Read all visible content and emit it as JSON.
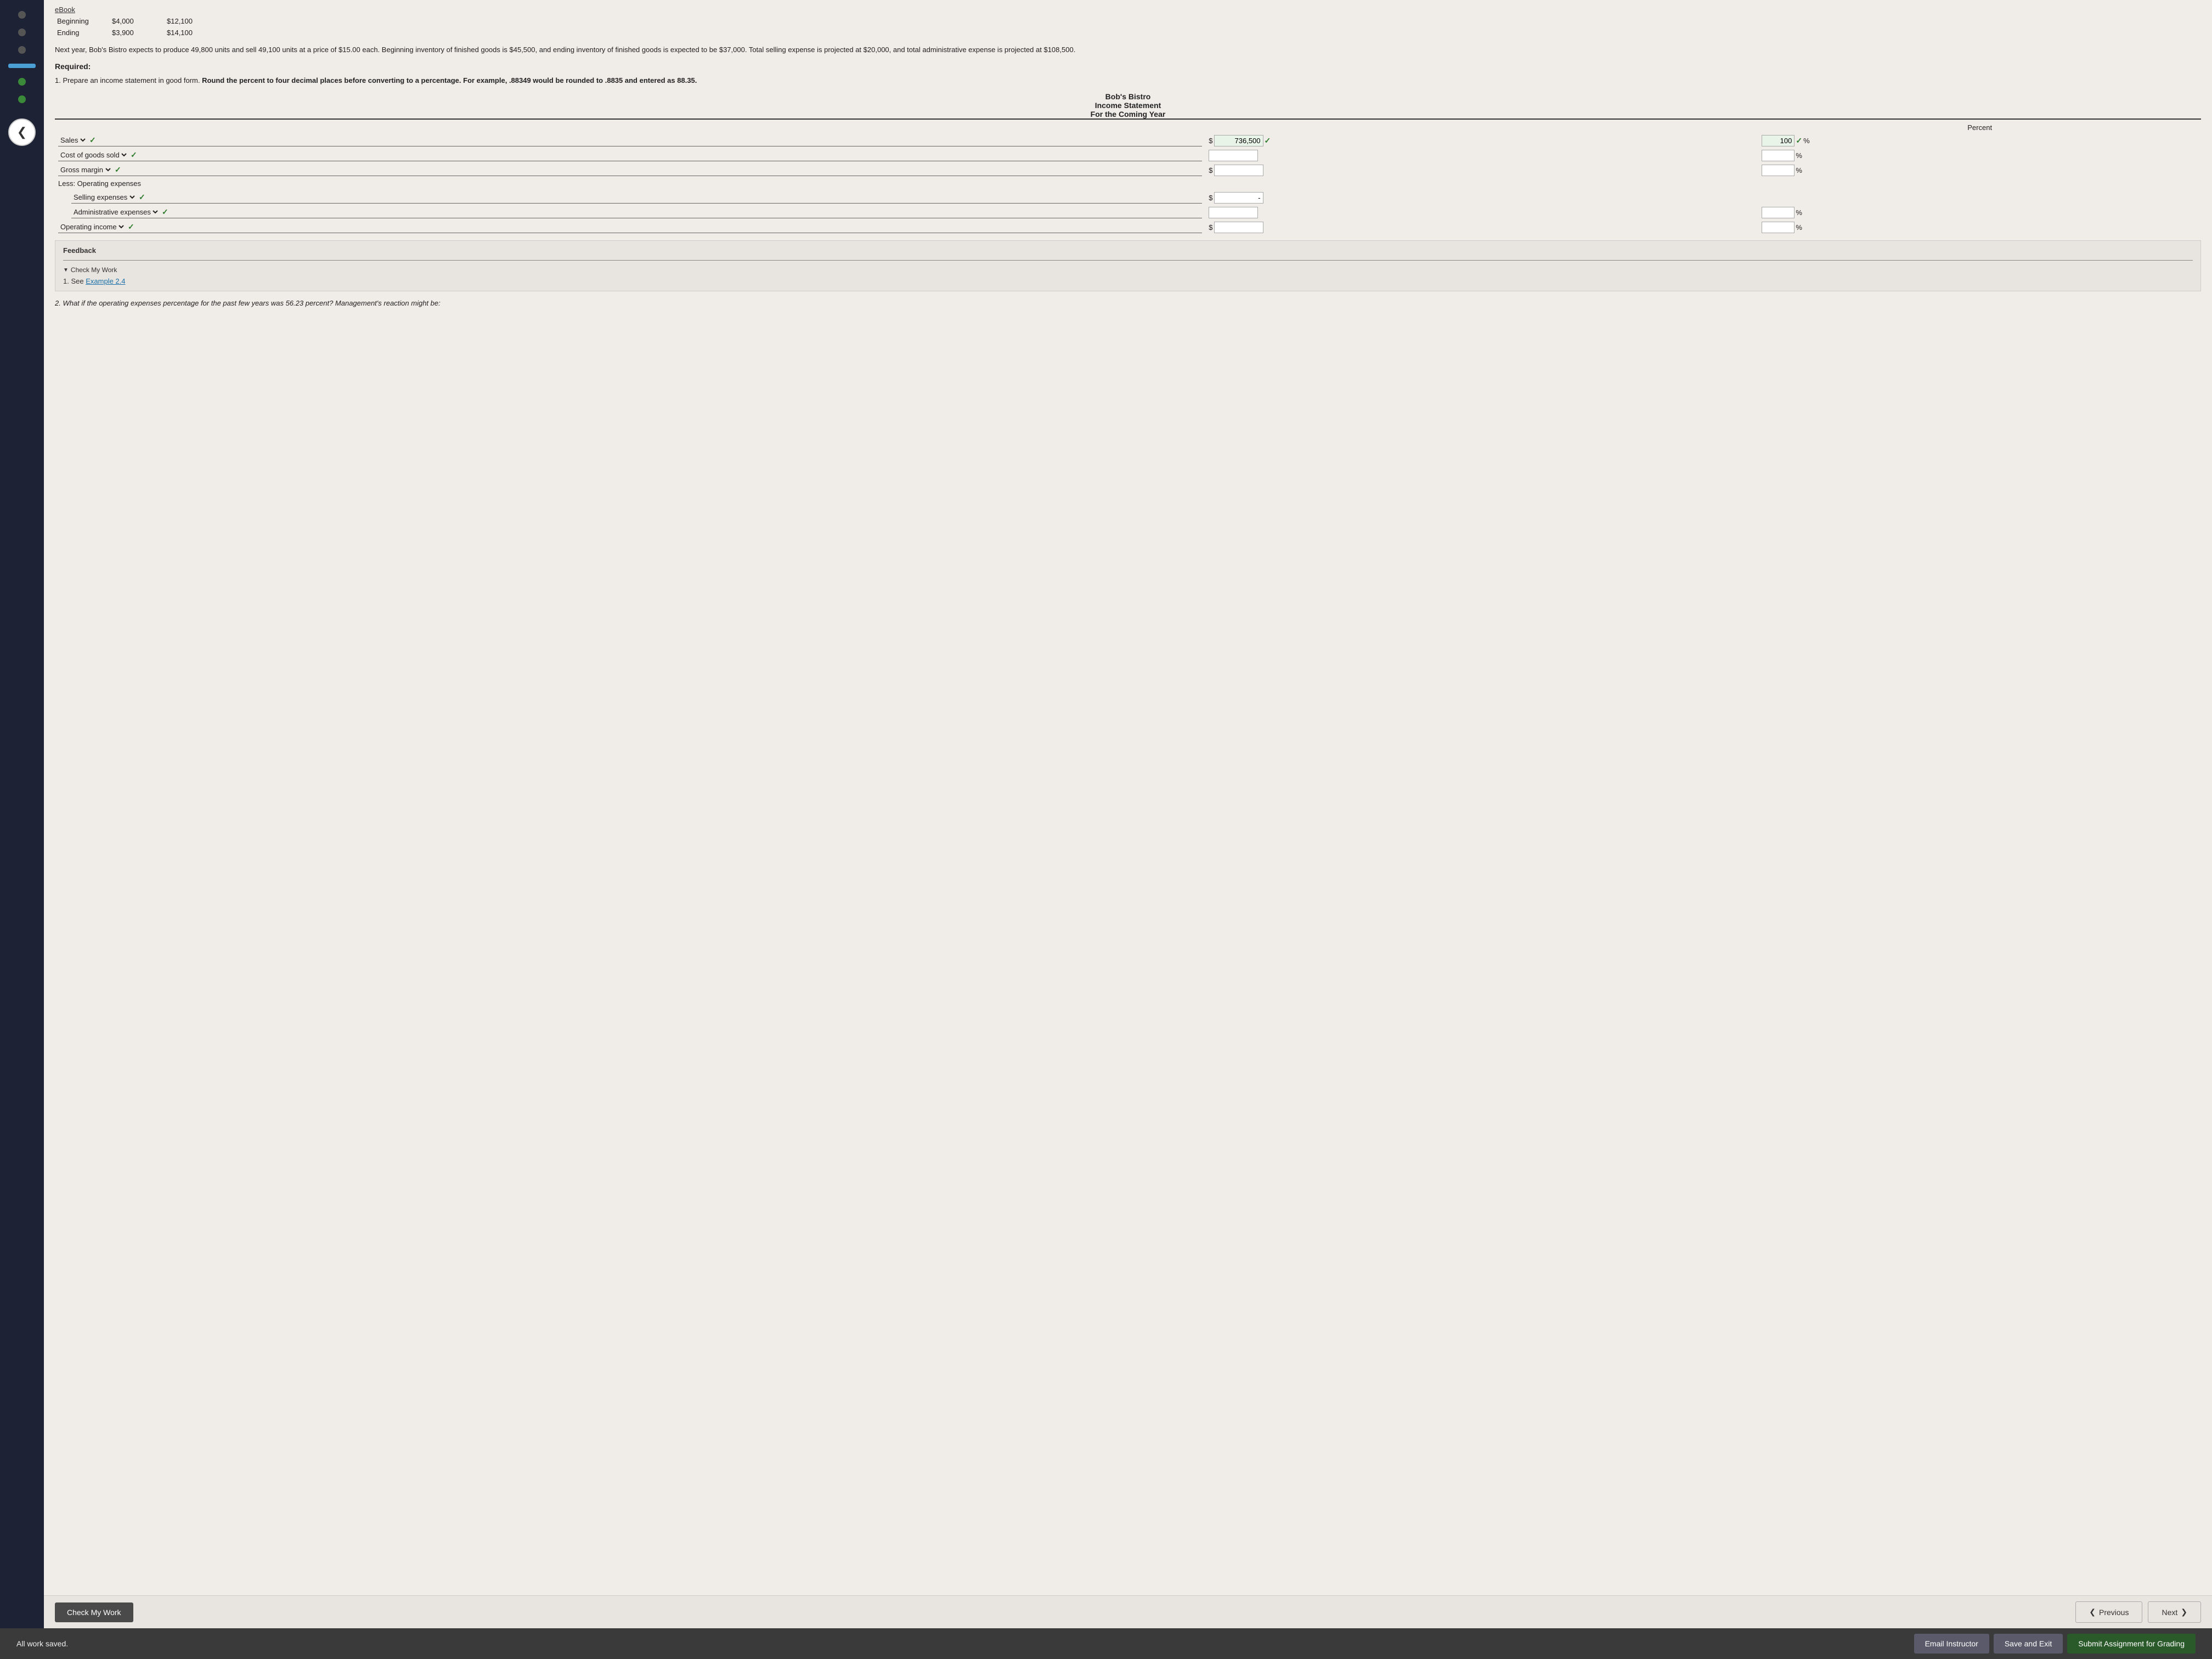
{
  "ebook": {
    "label": "eBook"
  },
  "inventory_table": {
    "rows": [
      {
        "label": "Beginning",
        "col1": "$4,000",
        "col2": "$12,100"
      },
      {
        "label": "Ending",
        "col1": "$3,900",
        "col2": "$14,100"
      }
    ]
  },
  "description": "Next year, Bob's Bistro expects to produce 49,800 units and sell 49,100 units at a price of $15.00 each. Beginning inventory of finished goods is $45,500, and ending inventory of finished goods is expected to be $37,000. Total selling expense is projected at $20,000, and total administrative expense is projected at $108,500.",
  "required_label": "Required:",
  "instruction": {
    "prefix": "1. Prepare an income statement in good form. ",
    "bold": "Round the percent to four decimal places before converting to a percentage. For example, .88349 would be rounded to .8835 and entered as 88.35.",
    "suffix": ""
  },
  "statement": {
    "company": "Bob's Bistro",
    "title": "Income Statement",
    "period": "For the Coming Year",
    "percent_header": "Percent",
    "rows": [
      {
        "label": "Sales",
        "indent": false,
        "has_dollar": true,
        "amount": "736,500",
        "amount_filled": true,
        "has_percent": true,
        "percent": "100",
        "percent_filled": true,
        "show_check_label": true,
        "show_check_amount": true,
        "show_check_percent": true
      },
      {
        "label": "Cost of goods sold",
        "indent": false,
        "has_dollar": false,
        "amount": "",
        "amount_filled": false,
        "has_percent": true,
        "percent": "",
        "percent_filled": false,
        "show_check_label": true,
        "show_check_amount": false,
        "show_check_percent": false
      },
      {
        "label": "Gross margin",
        "indent": false,
        "has_dollar": true,
        "amount": "",
        "amount_filled": false,
        "has_percent": true,
        "percent": "",
        "percent_filled": false,
        "show_check_label": true,
        "show_check_amount": false,
        "show_check_percent": false
      },
      {
        "label": "Less: Operating expenses",
        "indent": false,
        "has_dollar": false,
        "amount": "",
        "amount_filled": false,
        "has_percent": false,
        "percent": "",
        "percent_filled": false,
        "show_check_label": false,
        "show_check_amount": false,
        "show_check_percent": false,
        "static_label": true
      },
      {
        "label": "Selling expenses",
        "indent": true,
        "has_dollar": true,
        "dollar_value": "-",
        "amount": "",
        "amount_filled": false,
        "has_percent": false,
        "percent": "",
        "percent_filled": false,
        "show_check_label": true,
        "show_check_amount": false,
        "show_check_percent": false
      },
      {
        "label": "Administrative expenses",
        "indent": true,
        "has_dollar": false,
        "amount": "",
        "amount_filled": false,
        "has_percent": true,
        "percent": "",
        "percent_filled": false,
        "show_check_label": true,
        "show_check_amount": false,
        "show_check_percent": false
      },
      {
        "label": "Operating income",
        "indent": false,
        "has_dollar": true,
        "amount": "",
        "amount_filled": false,
        "has_percent": true,
        "percent": "",
        "percent_filled": false,
        "show_check_label": true,
        "show_check_amount": false,
        "show_check_percent": false
      }
    ]
  },
  "feedback": {
    "title": "Feedback",
    "check_my_work": "Check My Work",
    "hint": "1. See",
    "example_link": "Example 2.4"
  },
  "q2": {
    "text": "2. What if the operating expenses percentage for the past few years was 56.23 percent? Management's reaction might be:"
  },
  "bottom_bar": {
    "check_work_label": "Check My Work",
    "previous_label": "Previous",
    "next_label": "Next"
  },
  "footer": {
    "status": "All work saved.",
    "email_btn": "Email Instructor",
    "save_btn": "Save and Exit",
    "submit_btn": "Submit Assignment for Grading"
  },
  "icons": {
    "back": "❮",
    "check": "✓",
    "triangle": "▼",
    "chevron_left": "❮",
    "chevron_right": "❯"
  }
}
